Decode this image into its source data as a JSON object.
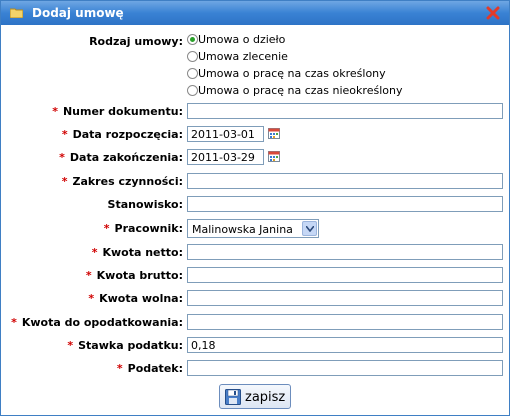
{
  "window": {
    "title": "Dodaj umowę"
  },
  "form": {
    "contract_type": {
      "label": "Rodzaj umowy:",
      "options": [
        {
          "label": "Umowa o dzieło",
          "selected": true
        },
        {
          "label": "Umowa zlecenie",
          "selected": false
        },
        {
          "label": "Umowa o pracę na czas określony",
          "selected": false
        },
        {
          "label": "Umowa o pracę na czas nieokreślony",
          "selected": false
        }
      ]
    },
    "document_number": {
      "label": "Numer dokumentu:",
      "value": ""
    },
    "start_date": {
      "label": "Data rozpoczęcia:",
      "value": "2011-03-01"
    },
    "end_date": {
      "label": "Data zakończenia:",
      "value": "2011-03-29"
    },
    "scope": {
      "label": "Zakres czynności:",
      "value": ""
    },
    "position": {
      "label": "Stanowisko:",
      "value": ""
    },
    "employee": {
      "label": "Pracownik:",
      "value": "Malinowska Janina"
    },
    "net_amount": {
      "label": "Kwota netto:",
      "value": ""
    },
    "gross_amount": {
      "label": "Kwota brutto:",
      "value": ""
    },
    "free_amount": {
      "label": "Kwota wolna:",
      "value": ""
    },
    "taxable_amount": {
      "label": "Kwota do opodatkowania:",
      "value": ""
    },
    "tax_rate": {
      "label": "Stawka podatku:",
      "value": "0,18"
    },
    "tax": {
      "label": "Podatek:",
      "value": ""
    },
    "required_mark": "*"
  },
  "buttons": {
    "save_label": "zapisz"
  },
  "colors": {
    "title_bar": "#3a82d4",
    "required": "#d00000",
    "radio_checked": "#2aa12a"
  },
  "icons": {
    "title": "folder-icon",
    "close": "close-icon",
    "calendar": "calendar-icon",
    "save": "floppy-disk-icon"
  }
}
